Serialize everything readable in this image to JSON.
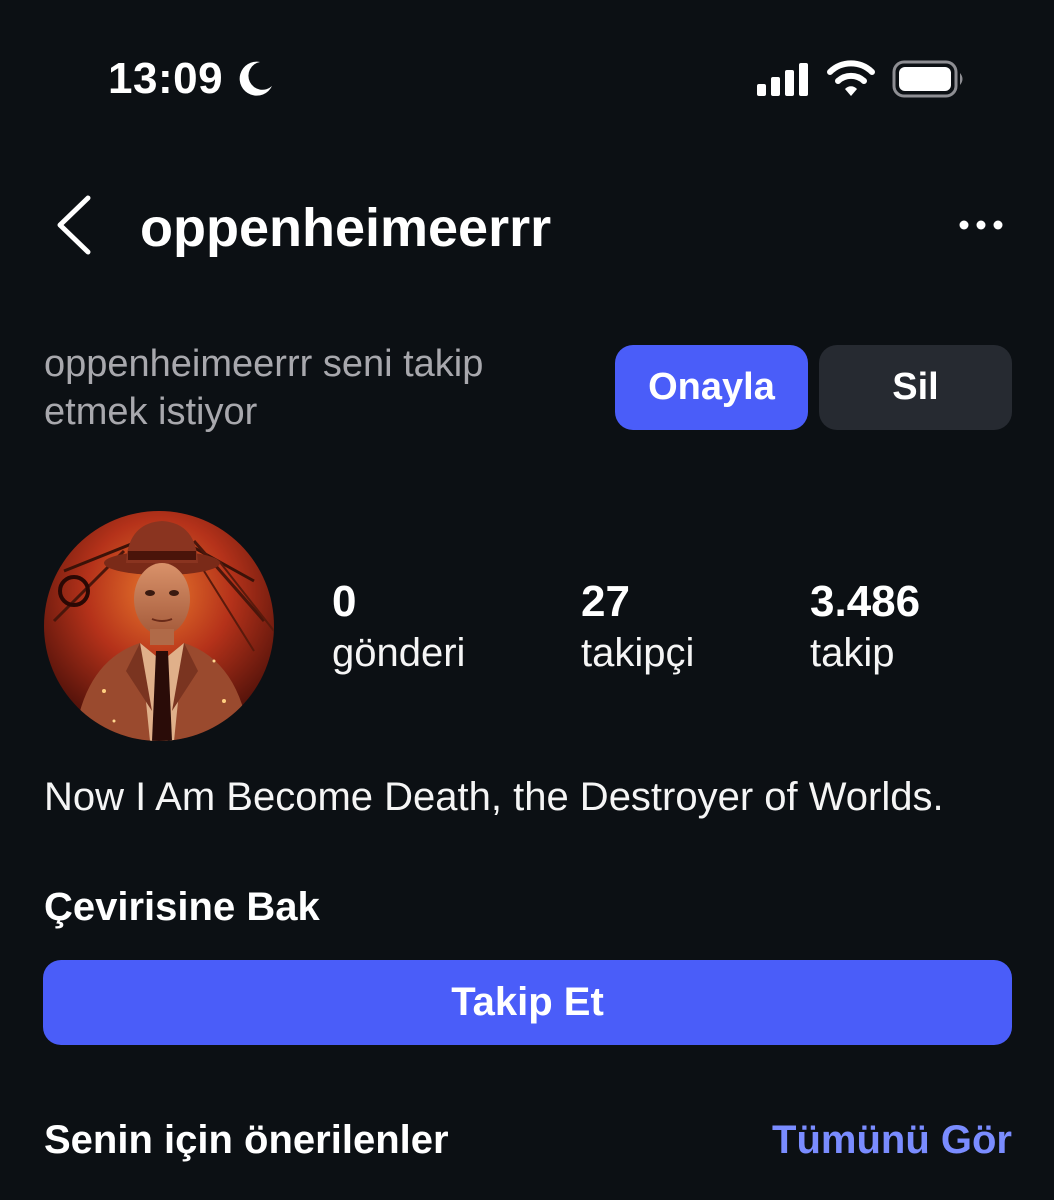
{
  "status_bar": {
    "time": "13:09",
    "focus_icon": "moon-icon",
    "signal_icon": "cellular-signal-icon",
    "wifi_icon": "wifi-icon",
    "battery_icon": "battery-icon"
  },
  "header": {
    "back_icon": "chevron-left-icon",
    "username": "oppenheimeerrr",
    "more_icon": "more-horizontal-icon"
  },
  "follow_request": {
    "message": "oppenheimeerrr seni takip etmek istiyor",
    "confirm_label": "Onayla",
    "delete_label": "Sil"
  },
  "profile": {
    "stats": [
      {
        "value": "0",
        "label": "gönderi"
      },
      {
        "value": "27",
        "label": "takipçi"
      },
      {
        "value": "3.486",
        "label": "takip"
      }
    ],
    "bio": "Now I Am Become Death, the Destroyer of Worlds.",
    "translate_label": "Çevirisine Bak",
    "follow_label": "Takip Et"
  },
  "suggestions": {
    "title": "Senin için önerilenler",
    "see_all_label": "Tümünü Gör"
  },
  "colors": {
    "background": "#0c1014",
    "accent": "#4a5df9",
    "secondary_button": "#262a31",
    "link": "#7a8cff",
    "muted_text": "#a8a8ad"
  }
}
